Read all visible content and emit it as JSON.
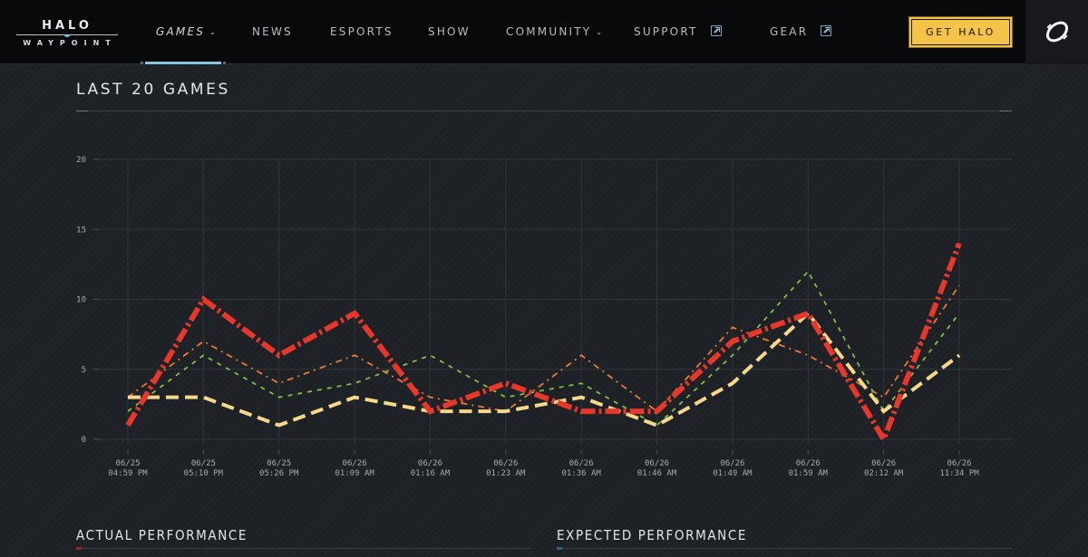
{
  "nav": {
    "logo": {
      "top": "HALO",
      "bottom": "WAYPOINT"
    },
    "items": [
      {
        "label": "GAMES",
        "dropdown": true,
        "external": false,
        "active": true
      },
      {
        "label": "NEWS",
        "dropdown": false,
        "external": false,
        "active": false
      },
      {
        "label": "ESPORTS",
        "dropdown": false,
        "external": false,
        "active": false
      },
      {
        "label": "SHOW",
        "dropdown": false,
        "external": false,
        "active": false
      },
      {
        "label": "COMMUNITY",
        "dropdown": true,
        "external": false,
        "active": false
      },
      {
        "label": "SUPPORT",
        "dropdown": false,
        "external": true,
        "active": false
      },
      {
        "label": "GEAR",
        "dropdown": false,
        "external": true,
        "active": false
      }
    ],
    "cta_label": "GET HALO",
    "profile_icon": "xbox-profile-icon"
  },
  "section": {
    "title": "LAST 20 GAMES"
  },
  "colors": {
    "accent_nav": "#8ac9dc",
    "cta": "#f3c447",
    "actual": "#e8372a",
    "expected_orange": "#e87a36",
    "green": "#7ec044",
    "yellow": "#f6d88a",
    "actual_marker": "#c0392b",
    "expected_marker": "#2d5f8e"
  },
  "chart_data": {
    "type": "line",
    "title": "LAST 20 GAMES",
    "xlabel": "",
    "ylabel": "",
    "ylim": [
      0,
      20
    ],
    "yticks": [
      0,
      5,
      10,
      15,
      20
    ],
    "grid": true,
    "legend": "none",
    "x": [
      [
        "06/25",
        "04:59 PM"
      ],
      [
        "06/25",
        "05:10 PM"
      ],
      [
        "06/25",
        "05:26 PM"
      ],
      [
        "06/26",
        "01:09 AM"
      ],
      [
        "06/26",
        "01:16 AM"
      ],
      [
        "06/26",
        "01:23 AM"
      ],
      [
        "06/26",
        "01:36 AM"
      ],
      [
        "06/26",
        "01:46 AM"
      ],
      [
        "06/26",
        "01:49 AM"
      ],
      [
        "06/26",
        "01:59 AM"
      ],
      [
        "06/26",
        "02:12 AM"
      ],
      [
        "06/26",
        "11:34 PM"
      ]
    ],
    "series": [
      {
        "name": "series-orange",
        "color": "#e87a36",
        "style": "dashdot-thin",
        "values": [
          3,
          7,
          4,
          6,
          3,
          2,
          6,
          2,
          8,
          6,
          3,
          11
        ]
      },
      {
        "name": "series-green",
        "color": "#7ec044",
        "style": "dash-thin",
        "values": [
          2,
          6,
          3,
          4,
          6,
          3,
          4,
          1,
          6,
          12,
          2,
          9
        ]
      },
      {
        "name": "series-yellow",
        "color": "#f6d88a",
        "style": "dash-thick",
        "values": [
          3,
          3,
          1,
          3,
          2,
          2,
          3,
          1,
          4,
          9,
          2,
          6
        ]
      },
      {
        "name": "series-red",
        "color": "#e8372a",
        "style": "dashdot-thick",
        "values": [
          1,
          10,
          6,
          9,
          2,
          4,
          2,
          2,
          7,
          9,
          0,
          14
        ]
      }
    ]
  },
  "bottom": {
    "actual_title": "ACTUAL PERFORMANCE",
    "expected_title": "EXPECTED PERFORMANCE"
  }
}
